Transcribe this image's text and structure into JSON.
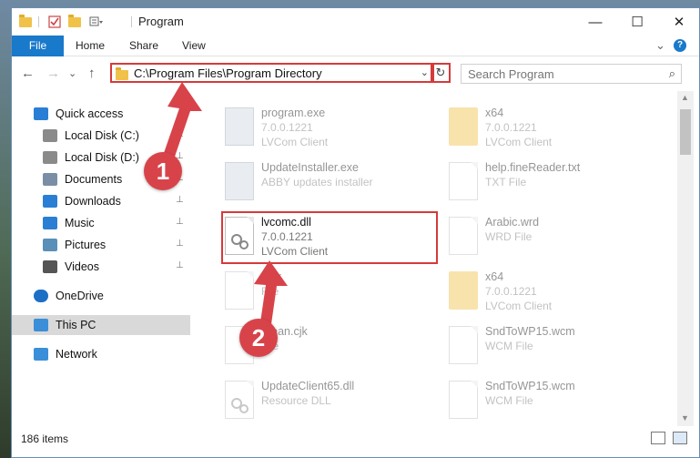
{
  "window": {
    "title": "Program",
    "controls": {
      "minimize": "—",
      "maximize": "☐",
      "close": "✕"
    }
  },
  "ribbon": {
    "tabs": [
      "File",
      "Home",
      "Share",
      "View"
    ],
    "expand": "⌄",
    "help": "?"
  },
  "navigation": {
    "back": "←",
    "forward": "→",
    "recent": "⌄",
    "up": "↑",
    "address": "C:\\Program Files\\Program Directory",
    "address_dropdown": "⌄",
    "refresh": "↻",
    "search_placeholder": "Search Program",
    "search_icon": "⌕"
  },
  "sidebar": {
    "items": [
      {
        "label": "Quick access",
        "icon": "star-icon",
        "pinned": false
      },
      {
        "label": "Local Disk (C:)",
        "icon": "drive-icon",
        "pinned": true
      },
      {
        "label": "Local Disk (D:)",
        "icon": "drive-icon",
        "pinned": true
      },
      {
        "label": "Documents",
        "icon": "documents-icon",
        "pinned": true
      },
      {
        "label": "Downloads",
        "icon": "download-icon",
        "pinned": true
      },
      {
        "label": "Music",
        "icon": "music-icon",
        "pinned": true
      },
      {
        "label": "Pictures",
        "icon": "pictures-icon",
        "pinned": true
      },
      {
        "label": "Videos",
        "icon": "videos-icon",
        "pinned": true
      },
      {
        "label": "OneDrive",
        "icon": "cloud-icon",
        "pinned": false
      },
      {
        "label": "This PC",
        "icon": "computer-icon",
        "pinned": false,
        "selected": true
      },
      {
        "label": "Network",
        "icon": "network-icon",
        "pinned": false
      }
    ],
    "pin_glyph": "📌"
  },
  "files": [
    {
      "name": "program.exe",
      "line1": "7.0.0.1221",
      "line2": "LVCom Client",
      "icon": "exe-icon",
      "faded": true
    },
    {
      "name": "x64",
      "line1": "7.0.0.1221",
      "line2": "LVCom Client",
      "icon": "folder-icon",
      "faded": true
    },
    {
      "name": "UpdateInstaller.exe",
      "line1": "ABBY updates installer",
      "line2": "",
      "icon": "exe-icon",
      "faded": true
    },
    {
      "name": "help.fineReader.txt",
      "line1": "TXT File",
      "line2": "",
      "icon": "doc-icon",
      "faded": true
    },
    {
      "name": "lvcomc.dll",
      "line1": "7.0.0.1221",
      "line2": "LVCom Client",
      "icon": "dll-icon",
      "faded": false
    },
    {
      "name": "Arabic.wrd",
      "line1": "WRD File",
      "line2": "",
      "icon": "doc-icon",
      "faded": true
    },
    {
      "name": "t.cjk",
      "line1": "File",
      "line2": "",
      "icon": "doc-icon",
      "faded": true
    },
    {
      "name": "x64",
      "line1": "7.0.0.1221",
      "line2": "LVCom Client",
      "icon": "folder-icon",
      "faded": true
    },
    {
      "name": "orean.cjk",
      "line1": "File",
      "line2": "",
      "icon": "doc-icon",
      "faded": true
    },
    {
      "name": "SndToWP15.wcm",
      "line1": "WCM File",
      "line2": "",
      "icon": "doc-icon",
      "faded": true
    },
    {
      "name": "UpdateClient65.dll",
      "line1": "Resource DLL",
      "line2": "",
      "icon": "dll-icon",
      "faded": true
    },
    {
      "name": "SndToWP15.wcm",
      "line1": "WCM File",
      "line2": "",
      "icon": "doc-icon",
      "faded": true
    }
  ],
  "status": {
    "item_count": "186 items"
  },
  "callouts": [
    "1",
    "2"
  ],
  "colors": {
    "accent": "#1979ca",
    "annotation": "#d63a3a",
    "badge": "#d8434a"
  }
}
